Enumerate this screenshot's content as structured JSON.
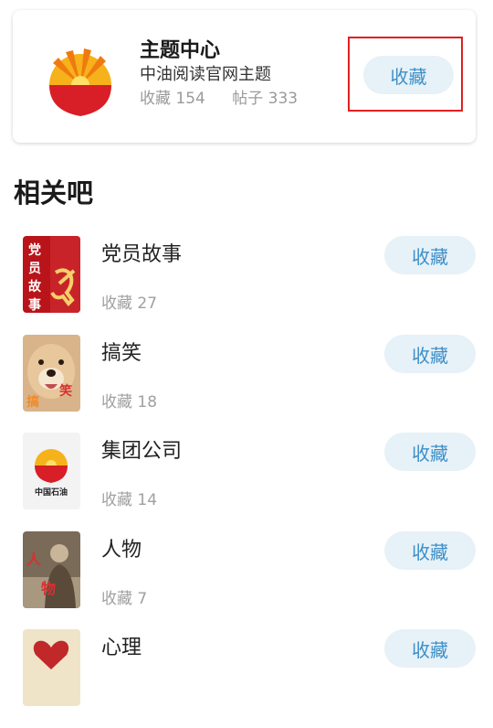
{
  "topic_card": {
    "title": "主题中心",
    "subtitle": "中油阅读官网主题",
    "favorites": "收藏 154",
    "posts": "帖子 333",
    "button_label": "收藏",
    "logo_text": ""
  },
  "section": {
    "title": "相关吧"
  },
  "bars": [
    {
      "name": "党员故事",
      "count": "收藏 27",
      "button_label": "收藏",
      "thumb_text": "党员故事"
    },
    {
      "name": "搞笑",
      "count": "收藏 18",
      "button_label": "收藏",
      "thumb_text_left": "搞",
      "thumb_text_right": "笑"
    },
    {
      "name": "集团公司",
      "count": "收藏 14",
      "button_label": "收藏",
      "thumb_caption": "中国石油"
    },
    {
      "name": "人物",
      "count": "收藏 7",
      "button_label": "收藏",
      "thumb_text": "人物"
    },
    {
      "name": "心理",
      "count": "",
      "button_label": "收藏"
    }
  ],
  "colors": {
    "accent": "#3d8fc8",
    "button_bg": "#e6f1f8",
    "highlight": "#e02020",
    "petrochina_red": "#d81e26",
    "petrochina_yellow": "#f6b21a"
  }
}
